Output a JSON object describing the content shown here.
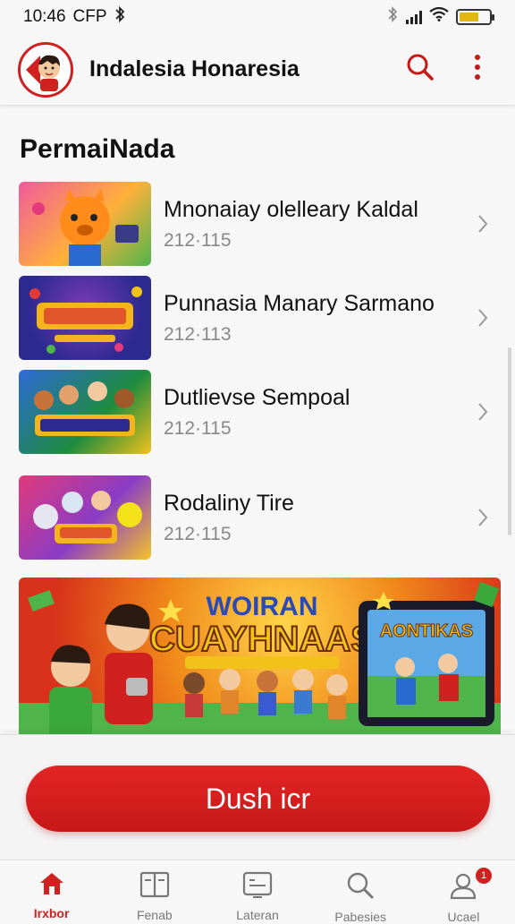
{
  "status_bar": {
    "time": "10:46",
    "carrier": "CFP"
  },
  "app_bar": {
    "title": "Indalesia Honaresia"
  },
  "section": {
    "title": "PermaiNada"
  },
  "items": [
    {
      "title": "Mnonaiay olelleary Kaldal",
      "subtitle": "212·115",
      "thumb_colors": [
        "#f05a9b",
        "#ffb03a",
        "#4fb54a"
      ]
    },
    {
      "title": "Punnasia Manary Sarmano",
      "subtitle": "212·113",
      "thumb_colors": [
        "#2b2a8f",
        "#7e3bb8",
        "#f3b51b"
      ]
    },
    {
      "title": "Dutlievse Sempoal",
      "subtitle": "212·115",
      "thumb_colors": [
        "#1f8c3e",
        "#2d6bd6",
        "#f0c21a"
      ]
    },
    {
      "title": "Rodaliny Tire",
      "subtitle": "212·115",
      "thumb_colors": [
        "#e23a7a",
        "#8a3cc6",
        "#f4c32a"
      ]
    }
  ],
  "banner": {
    "headline_top": "WOIRAN",
    "headline_main": "CUAYHNAAS",
    "screen_text": "AONTIKAS"
  },
  "cta": {
    "label": "Dush icr"
  },
  "bottom_nav": [
    {
      "label": "Irxbor",
      "icon": "home-icon",
      "active": true
    },
    {
      "label": "Fenab",
      "icon": "book-icon",
      "active": false
    },
    {
      "label": "Lateran",
      "icon": "screen-icon",
      "active": false
    },
    {
      "label": "Pabesies",
      "icon": "search-icon",
      "active": false
    },
    {
      "label": "Ucael",
      "icon": "profile-icon",
      "active": false,
      "badge": "1"
    }
  ],
  "colors": {
    "accent": "#d02020",
    "battery": "#e2b714"
  }
}
